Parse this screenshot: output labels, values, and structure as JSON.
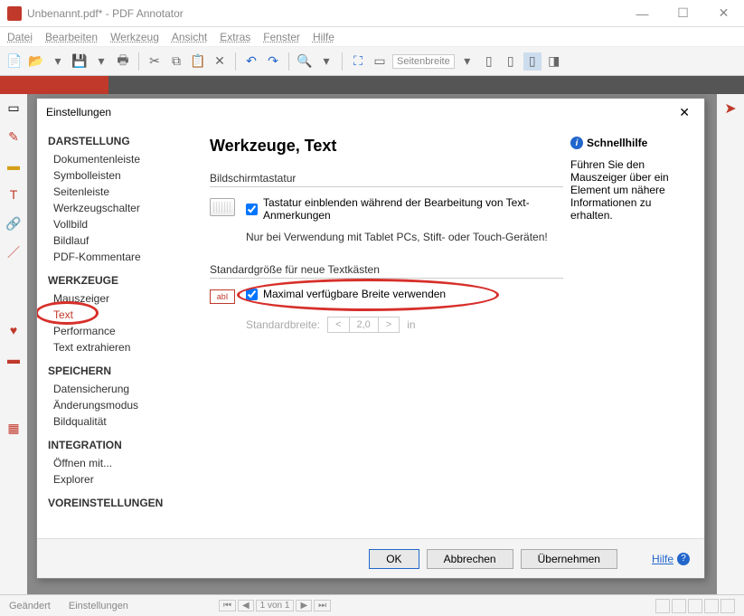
{
  "window": {
    "title": "Unbenannt.pdf* - PDF Annotator"
  },
  "menubar": [
    "Datei",
    "Bearbeiten",
    "Werkzeug",
    "Ansicht",
    "Extras",
    "Fenster",
    "Hilfe"
  ],
  "toolbar": {
    "zoom_label": "Seitenbreite"
  },
  "statusbar": {
    "left1": "Geändert",
    "left2": "Einstellungen",
    "page": "1 von 1"
  },
  "dialog": {
    "title": "Einstellungen",
    "buttons": {
      "ok": "OK",
      "cancel": "Abbrechen",
      "apply": "Übernehmen",
      "help": "Hilfe"
    }
  },
  "sidebar": {
    "cat1": "DARSTELLUNG",
    "items1": [
      "Dokumentenleiste",
      "Symbolleisten",
      "Seitenleiste",
      "Werkzeugschalter",
      "Vollbild",
      "Bildlauf",
      "PDF-Kommentare"
    ],
    "cat2": "WERKZEUGE",
    "items2": [
      "Mauszeiger",
      "Text",
      "Performance",
      "Text extrahieren"
    ],
    "cat3": "SPEICHERN",
    "items3": [
      "Datensicherung",
      "Änderungsmodus",
      "Bildqualität"
    ],
    "cat4": "INTEGRATION",
    "items4": [
      "Öffnen mit...",
      "Explorer"
    ],
    "cat5": "VOREINSTELLUNGEN"
  },
  "settings": {
    "heading": "Werkzeuge, Text",
    "group1": {
      "label": "Bildschirmtastatur",
      "check": "Tastatur einblenden während der Bearbeitung von Text-Anmerkungen",
      "note": "Nur bei Verwendung mit Tablet PCs, Stift- oder Touch-Geräten!"
    },
    "group2": {
      "label": "Standardgröße für neue Textkästen",
      "check": "Maximal verfügbare Breite verwenden",
      "width_label": "Standardbreite:",
      "width_value": "2,0",
      "width_unit": "in"
    }
  },
  "help": {
    "title": "Schnellhilfe",
    "text": "Führen Sie den Mauszeiger über ein Element um nähere Informationen zu erhalten."
  }
}
